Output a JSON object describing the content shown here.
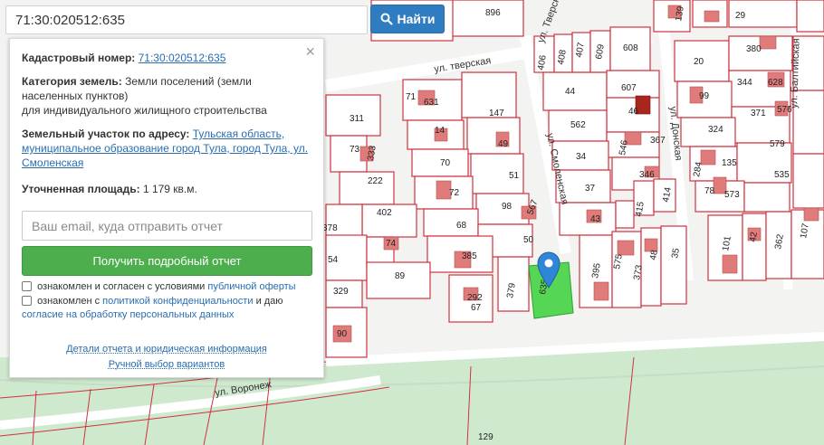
{
  "search": {
    "value": "71:30:020512:635",
    "button_label": "Найти",
    "button_icon": "search-icon"
  },
  "panel": {
    "cadastral_label": "Кадастровый номер:",
    "cadastral_value": "71:30:020512:635",
    "category_label": "Категория земель:",
    "category_value": "Земли поселений (земли населенных пунктов)",
    "category_usage": "для индивидуального жилищного строительства",
    "address_label": "Земельный участок по адресу:",
    "address_value": "Тульская область, муниципальное образование город Тула, город Тула, ул. Смоленская",
    "area_label": "Уточненная площадь:",
    "area_value": "1 179 кв.м.",
    "email_placeholder": "Ваш email, куда отправить отчет",
    "report_button": "Получить подробный отчет",
    "consent1_text": "ознакомлен и согласен с условиями",
    "consent1_link": "публичной оферты",
    "consent2_text": "ознакомлен с",
    "consent2_link1": "политикой конфиденциальности",
    "consent2_mid": "и даю",
    "consent2_link2": "согласие на обработку персональных данных",
    "details_link": "Детали отчета и юридическая информация",
    "manual_link": "Ручной выбор вариантов"
  },
  "map": {
    "streets": [
      "ул. тверская",
      "ул. Смоленская",
      "ул. Донская",
      "ул. Тверская",
      "ул. Балтийская",
      "ул. Воронеж"
    ],
    "plots": [
      "896",
      "139",
      "29",
      "406",
      "408",
      "407",
      "609",
      "608",
      "380",
      "20",
      "344",
      "628",
      "44",
      "607",
      "99",
      "371",
      "576",
      "46",
      "562",
      "324",
      "367",
      "579",
      "546",
      "135",
      "34",
      "346",
      "284",
      "78",
      "573",
      "535",
      "37",
      "414",
      "415",
      "43",
      "101",
      "42",
      "362",
      "107",
      "395",
      "575",
      "373",
      "48",
      "35",
      "631",
      "147",
      "311",
      "14",
      "73",
      "49",
      "333",
      "70",
      "51",
      "222",
      "72",
      "98",
      "567",
      "402",
      "68",
      "50",
      "378",
      "74",
      "385",
      "54",
      "89",
      "329",
      "379",
      "292",
      "67",
      "90",
      "129",
      "71"
    ],
    "selected_plot": "635",
    "colors": {
      "selected": "#52d452",
      "plot_border": "#d0313f",
      "house": "#e07b7b",
      "green_area": "#cfeacf",
      "pin": "#2f86d6"
    }
  }
}
